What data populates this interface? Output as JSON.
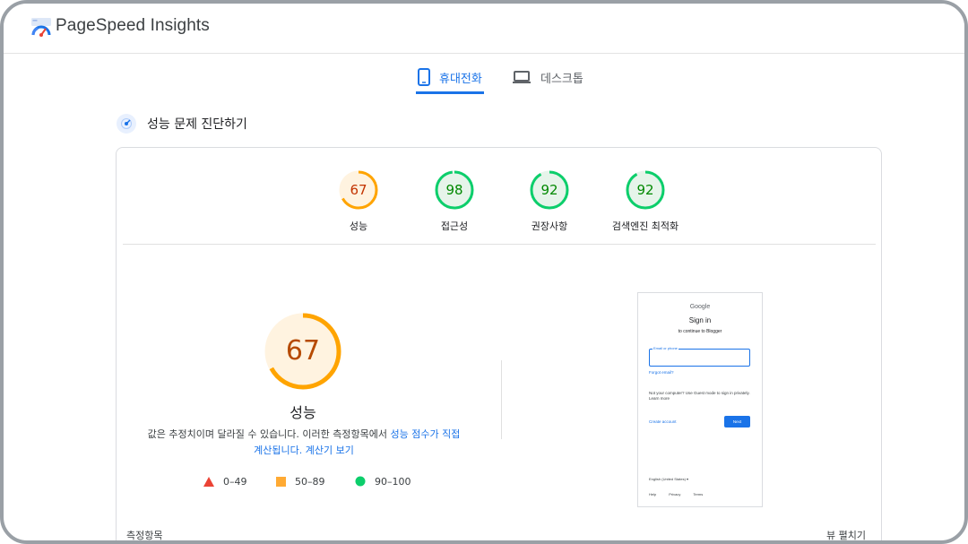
{
  "header": {
    "brand": "PageSpeed Insights"
  },
  "tabs": [
    {
      "label": "휴대전화",
      "icon": "smartphone-icon",
      "selected": true
    },
    {
      "label": "데스크톱",
      "icon": "laptop-icon",
      "selected": false
    }
  ],
  "diagnose": {
    "title": "성능 문제 진단하기",
    "icon": "lighthouse-icon"
  },
  "categories": [
    {
      "score": "67",
      "label": "성능",
      "status": "average"
    },
    {
      "score": "98",
      "label": "접근성",
      "status": "pass"
    },
    {
      "score": "92",
      "label": "권장사항",
      "status": "pass"
    },
    {
      "score": "92",
      "label": "검색엔진 최적화",
      "status": "pass"
    }
  ],
  "performance": {
    "score": "67",
    "label": "성능",
    "note_before": "값은 추정치이며 달라질 수 있습니다. 이러한 측정항목에서 ",
    "note_link": "성능 점수가 직접 계산됩니다.",
    "note_between": " ",
    "calc_link": "계산기 보기"
  },
  "legend": [
    {
      "range": "0–49",
      "color": "#eb4335"
    },
    {
      "range": "50–89",
      "color": "#ffaa33"
    },
    {
      "range": "90–100",
      "color": "#0cce6b"
    }
  ],
  "colors": {
    "fail": "#ff4e42",
    "average": "#ffa400",
    "pass": "#0cce6b",
    "accent": "#1a73e8"
  },
  "screenshot": {
    "google": "Google",
    "title": "Sign in",
    "subtitle": "to continue to Blogger",
    "placeholder": "Email or phone",
    "forgot": "Forgot email?",
    "guest": "Not your computer? Use Guest mode to sign in privately. Learn more",
    "create": "Create account",
    "next": "Next",
    "language": "English (United States)   ▾",
    "footer": [
      "Help",
      "Privacy",
      "Terms"
    ]
  },
  "metrics": {
    "label": "측정항목",
    "view": "뷰 펼치기"
  }
}
